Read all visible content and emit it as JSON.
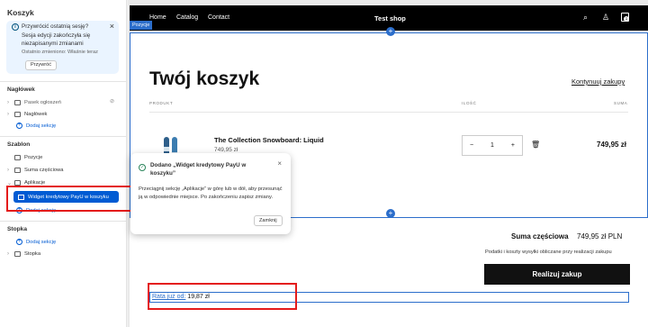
{
  "sidebar": {
    "title": "Koszyk",
    "banner": {
      "title": "Przywrócić ostatnią sesję?",
      "body": "Sesja edycji zakończyła się niezapisanymi zmianami",
      "status": "Ostatnio zmieniono: Właśnie teraz",
      "button": "Przywróć"
    },
    "header_section": {
      "title": "Nagłówek",
      "items": [
        "Pasek ogłoszeń",
        "Nagłówek"
      ],
      "add": "Dodaj sekcję"
    },
    "template_section": {
      "title": "Szablon",
      "items": [
        "Pozycje",
        "Suma częściowa",
        "Aplikacje"
      ],
      "selected": "Widget kredytowy PayU w koszyku",
      "add": "Dodaj sekcję"
    },
    "footer_section": {
      "title": "Stopka",
      "add": "Dodaj sekcję",
      "items": [
        "Stopka"
      ]
    }
  },
  "store": {
    "nav": [
      "Home",
      "Catalog",
      "Contact"
    ],
    "brand": "Test shop",
    "cart_count": "1",
    "section_tag": "Pozycje",
    "title": "Twój koszyk",
    "continue": "Kontynuuj zakupy",
    "columns": {
      "product": "PRODUKT",
      "qty": "ILOŚĆ",
      "total": "SUMA"
    },
    "item": {
      "name": "The Collection Snowboard: Liquid",
      "price": "749,95 zł",
      "quantity": "1",
      "total": "749,95 zł"
    },
    "subtotal_label": "Suma częściowa",
    "subtotal_value": "749,95 zł PLN",
    "taxes_note": "Podatki i koszty wysyłki obliczane przy realizacji zakupu",
    "checkout": "Realizuj zakup",
    "rata_link": "Rata już od:",
    "rata_value": " 19,87 zł"
  },
  "toast": {
    "title": "Dodano „Widget kredytowy PayU w koszyku”",
    "body": "Przeciągnij sekcję „Aplikacje” w górę lub w dół, aby przesunąć ją w odpowiednie miejsce. Po zakończeniu zapisz zmiany.",
    "button": "Zamknij"
  },
  "colors": {
    "accent": "#005bd3",
    "highlight": "#e41b1b",
    "selection": "#2c6ecb"
  }
}
